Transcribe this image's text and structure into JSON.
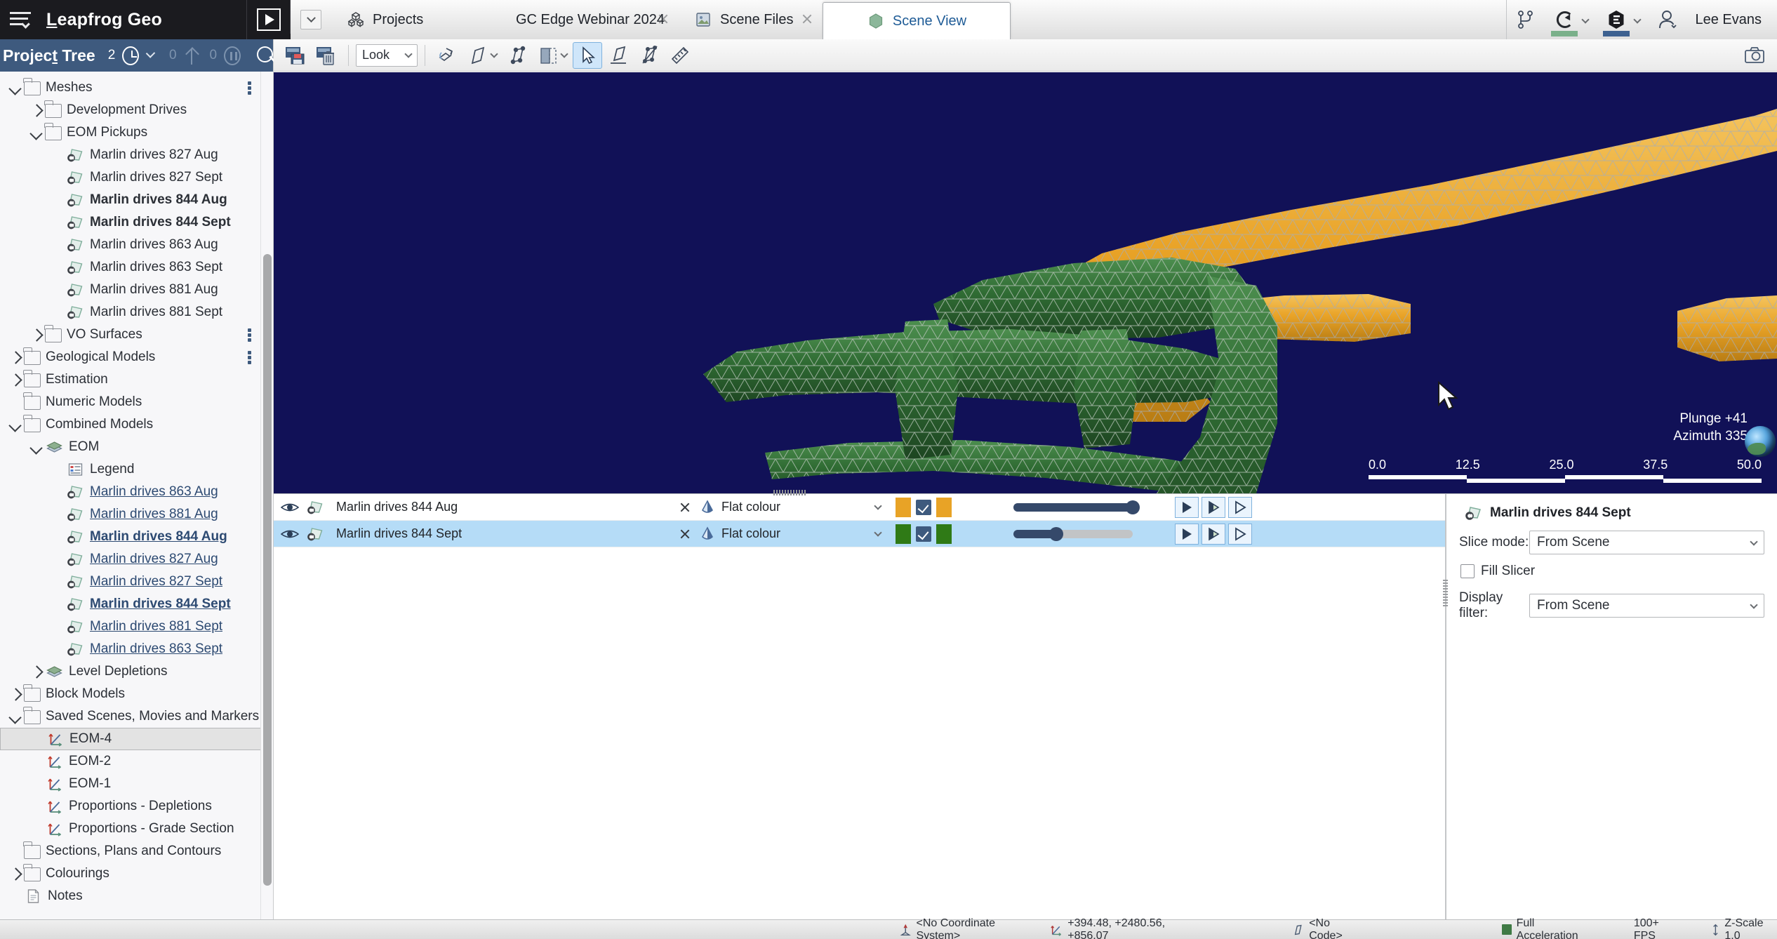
{
  "titlebar": {
    "app_name": "Leapfrog Geo",
    "menu_icon": "hamburger-icon",
    "play_icon": "play-icon",
    "tab_dropdown_icon": "chevron-down-icon",
    "tabs": [
      {
        "label": "Projects",
        "icon": "projects-cubes-icon",
        "closable": false,
        "active": false
      },
      {
        "label": "GC Edge Webinar 2024",
        "icon": "central-c-icon",
        "closable": true,
        "active": false
      },
      {
        "label": "Scene Files",
        "icon": "scene-files-icon",
        "closable": true,
        "active": false
      },
      {
        "label": "Scene View",
        "icon": "scene-view-hex-icon",
        "closable": false,
        "active": true
      }
    ],
    "right_icons": [
      {
        "name": "branch-icon",
        "accent": ""
      },
      {
        "name": "central-icon",
        "accent": "#7ab08a"
      },
      {
        "name": "edge-hex-icon",
        "accent": "#3d6190"
      }
    ],
    "user": {
      "name": "Lee Evans",
      "icon": "user-avatar-icon"
    }
  },
  "project_tree": {
    "title": "Project Tree",
    "title_mnemonic": "T",
    "history_count": "2",
    "history_icon": "clock-icon",
    "up_count": "0",
    "up_icon": "up-arrow-icon",
    "pause_count": "0",
    "pause_icon": "pause-circle-icon",
    "search_icon": "search-icon",
    "items": [
      {
        "label": "Meshes",
        "depth": 0,
        "twisty": "down",
        "icon": "folder",
        "bold": false,
        "link": false,
        "menu": true,
        "selected": false
      },
      {
        "label": "Development Drives",
        "depth": 1,
        "twisty": "right",
        "icon": "folder",
        "bold": false,
        "link": false,
        "menu": false,
        "selected": false
      },
      {
        "label": "EOM Pickups",
        "depth": 1,
        "twisty": "down",
        "icon": "folder",
        "bold": false,
        "link": false,
        "menu": false,
        "selected": false
      },
      {
        "label": "Marlin drives 827 Aug",
        "depth": 2,
        "twisty": "none",
        "icon": "mesh",
        "bold": false,
        "link": false,
        "menu": false,
        "selected": false
      },
      {
        "label": "Marlin drives 827 Sept",
        "depth": 2,
        "twisty": "none",
        "icon": "mesh",
        "bold": false,
        "link": false,
        "menu": false,
        "selected": false
      },
      {
        "label": "Marlin drives 844 Aug",
        "depth": 2,
        "twisty": "none",
        "icon": "mesh",
        "bold": true,
        "link": false,
        "menu": false,
        "selected": false
      },
      {
        "label": "Marlin drives 844 Sept",
        "depth": 2,
        "twisty": "none",
        "icon": "mesh",
        "bold": true,
        "link": false,
        "menu": false,
        "selected": false
      },
      {
        "label": "Marlin drives 863 Aug",
        "depth": 2,
        "twisty": "none",
        "icon": "mesh",
        "bold": false,
        "link": false,
        "menu": false,
        "selected": false
      },
      {
        "label": "Marlin drives 863 Sept",
        "depth": 2,
        "twisty": "none",
        "icon": "mesh",
        "bold": false,
        "link": false,
        "menu": false,
        "selected": false
      },
      {
        "label": "Marlin drives 881 Aug",
        "depth": 2,
        "twisty": "none",
        "icon": "mesh",
        "bold": false,
        "link": false,
        "menu": false,
        "selected": false
      },
      {
        "label": "Marlin drives 881 Sept",
        "depth": 2,
        "twisty": "none",
        "icon": "mesh",
        "bold": false,
        "link": false,
        "menu": false,
        "selected": false
      },
      {
        "label": "VO Surfaces",
        "depth": 1,
        "twisty": "right",
        "icon": "folder",
        "bold": false,
        "link": false,
        "menu": true,
        "selected": false
      },
      {
        "label": "Geological Models",
        "depth": 0,
        "twisty": "right",
        "icon": "folder",
        "bold": false,
        "link": false,
        "menu": true,
        "selected": false
      },
      {
        "label": "Estimation",
        "depth": 0,
        "twisty": "right",
        "icon": "folder",
        "bold": false,
        "link": false,
        "menu": false,
        "selected": false
      },
      {
        "label": "Numeric Models",
        "depth": 0,
        "twisty": "none",
        "icon": "folder",
        "bold": false,
        "link": false,
        "menu": false,
        "selected": false
      },
      {
        "label": "Combined Models",
        "depth": 0,
        "twisty": "down",
        "icon": "folder",
        "bold": false,
        "link": false,
        "menu": false,
        "selected": false
      },
      {
        "label": "EOM",
        "depth": 1,
        "twisty": "down",
        "icon": "stack",
        "bold": false,
        "link": false,
        "menu": false,
        "selected": false
      },
      {
        "label": "Legend",
        "depth": 2,
        "twisty": "none",
        "icon": "legend",
        "bold": false,
        "link": false,
        "menu": false,
        "selected": false
      },
      {
        "label": "Marlin drives 863 Aug",
        "depth": 2,
        "twisty": "none",
        "icon": "mesh",
        "bold": false,
        "link": true,
        "menu": false,
        "selected": false
      },
      {
        "label": "Marlin drives 881 Aug",
        "depth": 2,
        "twisty": "none",
        "icon": "mesh",
        "bold": false,
        "link": true,
        "menu": false,
        "selected": false
      },
      {
        "label": "Marlin drives 844 Aug",
        "depth": 2,
        "twisty": "none",
        "icon": "mesh",
        "bold": true,
        "link": true,
        "menu": false,
        "selected": false
      },
      {
        "label": "Marlin drives 827 Aug",
        "depth": 2,
        "twisty": "none",
        "icon": "mesh",
        "bold": false,
        "link": true,
        "menu": false,
        "selected": false
      },
      {
        "label": "Marlin drives 827 Sept",
        "depth": 2,
        "twisty": "none",
        "icon": "mesh",
        "bold": false,
        "link": true,
        "menu": false,
        "selected": false
      },
      {
        "label": "Marlin drives 844 Sept",
        "depth": 2,
        "twisty": "none",
        "icon": "mesh",
        "bold": true,
        "link": true,
        "menu": false,
        "selected": false
      },
      {
        "label": "Marlin drives 881 Sept",
        "depth": 2,
        "twisty": "none",
        "icon": "mesh",
        "bold": false,
        "link": true,
        "menu": false,
        "selected": false
      },
      {
        "label": "Marlin drives 863 Sept",
        "depth": 2,
        "twisty": "none",
        "icon": "mesh",
        "bold": false,
        "link": true,
        "menu": false,
        "selected": false
      },
      {
        "label": "Level Depletions",
        "depth": 1,
        "twisty": "right",
        "icon": "stack",
        "bold": false,
        "link": false,
        "menu": false,
        "selected": false
      },
      {
        "label": "Block Models",
        "depth": 0,
        "twisty": "right",
        "icon": "folder",
        "bold": false,
        "link": false,
        "menu": false,
        "selected": false
      },
      {
        "label": "Saved Scenes, Movies and Markers",
        "depth": 0,
        "twisty": "down",
        "icon": "folder",
        "bold": false,
        "link": false,
        "menu": false,
        "selected": false
      },
      {
        "label": "EOM-4",
        "depth": 1,
        "twisty": "none",
        "icon": "axes",
        "bold": false,
        "link": false,
        "menu": false,
        "selected": true
      },
      {
        "label": "EOM-2",
        "depth": 1,
        "twisty": "none",
        "icon": "axes",
        "bold": false,
        "link": false,
        "menu": false,
        "selected": false
      },
      {
        "label": "EOM-1",
        "depth": 1,
        "twisty": "none",
        "icon": "axes",
        "bold": false,
        "link": false,
        "menu": false,
        "selected": false
      },
      {
        "label": "Proportions - Depletions",
        "depth": 1,
        "twisty": "none",
        "icon": "axes",
        "bold": false,
        "link": false,
        "menu": false,
        "selected": false
      },
      {
        "label": "Proportions - Grade Section",
        "depth": 1,
        "twisty": "none",
        "icon": "axes",
        "bold": false,
        "link": false,
        "menu": false,
        "selected": false
      },
      {
        "label": "Sections, Plans and Contours",
        "depth": 0,
        "twisty": "none",
        "icon": "folder",
        "bold": false,
        "link": false,
        "menu": false,
        "selected": false
      },
      {
        "label": "Colourings",
        "depth": 0,
        "twisty": "right",
        "icon": "folder",
        "bold": false,
        "link": false,
        "menu": false,
        "selected": false
      },
      {
        "label": "Notes",
        "depth": 0,
        "twisty": "none",
        "icon": "note",
        "bold": false,
        "link": false,
        "menu": false,
        "selected": false
      }
    ]
  },
  "scene_toolbar": {
    "buttons": [
      {
        "name": "save-scene-button",
        "icon": "save-scene-icon",
        "active": false,
        "chevron": false
      },
      {
        "name": "delete-scene-button",
        "icon": "delete-scene-icon",
        "active": false,
        "chevron": false
      }
    ],
    "look_label": "Look",
    "tools": [
      {
        "name": "orbit-tool",
        "icon": "orbit-icon",
        "active": false,
        "chevron": false
      },
      {
        "name": "draw-line-tool",
        "icon": "pencil-plane-icon",
        "active": false,
        "chevron": true
      },
      {
        "name": "polyline-tool",
        "icon": "polygon-nodes-icon",
        "active": false,
        "chevron": false
      },
      {
        "name": "clipping-tool",
        "icon": "clipping-box-icon",
        "active": false,
        "chevron": true
      },
      {
        "name": "select-tool",
        "icon": "arrow-cursor-icon",
        "active": true,
        "chevron": false
      },
      {
        "name": "draw-plane-tool",
        "icon": "pencil-base-icon",
        "active": false,
        "chevron": false
      },
      {
        "name": "slicer-tool",
        "icon": "slicer-icon",
        "active": false,
        "chevron": false
      },
      {
        "name": "measure-tool",
        "icon": "ruler-icon",
        "active": false,
        "chevron": false
      }
    ],
    "camera_icon": "camera-icon"
  },
  "viewport": {
    "background_color": "#111157",
    "meshes": [
      {
        "name": "Marlin drives 844 Aug",
        "color": "#e8a326",
        "wire": "#9aa0a8"
      },
      {
        "name": "Marlin drives 844 Sept",
        "color": "#2f6b33",
        "wire": "#a6b3a8"
      }
    ],
    "scalebar": {
      "ticks": [
        "0.0",
        "12.5",
        "25.0",
        "37.5",
        "50.0"
      ]
    },
    "orientation": {
      "plunge": "Plunge +41",
      "azimuth": "Azimuth 335"
    },
    "globe_icon": "globe-orientation-icon",
    "cursor_icon": "mouse-pointer-icon"
  },
  "scene_objects": {
    "rows": [
      {
        "name": "Marlin drives 844 Aug",
        "visible_icon": "eye-icon",
        "object_icon": "mesh-icon",
        "remove_icon": "close-icon",
        "colour_icon": "colour-drop-icon",
        "colour_mode": "Flat colour",
        "swatch_left": "#e8a326",
        "swatch_right": "#e8a326",
        "checked": true,
        "opacity": 100,
        "selected": false
      },
      {
        "name": "Marlin drives 844 Sept",
        "visible_icon": "eye-icon",
        "object_icon": "mesh-icon",
        "remove_icon": "close-icon",
        "colour_icon": "colour-drop-icon",
        "colour_mode": "Flat colour",
        "swatch_left": "#2f7a16",
        "swatch_right": "#2f7a16",
        "checked": true,
        "opacity": 36,
        "selected": true
      }
    ],
    "play_buttons": [
      "play-solid-icon",
      "play-half-icon",
      "play-outline-icon"
    ]
  },
  "properties": {
    "title": "Marlin drives 844 Sept",
    "title_icon": "mesh-icon",
    "slice_mode_label": "Slice mode:",
    "slice_mode_value": "From Scene",
    "fill_slicer_label": "Fill Slicer",
    "fill_slicer_checked": false,
    "display_filter_label": "Display filter:",
    "display_filter_value": "From Scene"
  },
  "statusbar": {
    "coordinate_system": "<No Coordinate System>",
    "coordinate_icon": "survey-marker-icon",
    "coordinates": "+394.48, +2480.56, +856.07",
    "coordinates_icon": "axes-icon",
    "code": "<No Code>",
    "code_icon": "pencil-icon",
    "acceleration": "Full Acceleration",
    "acceleration_icon": "monitor-icon",
    "fps": "100+ FPS",
    "zscale": "Z-Scale 1.0",
    "zscale_icon": "vertical-arrows-icon"
  }
}
